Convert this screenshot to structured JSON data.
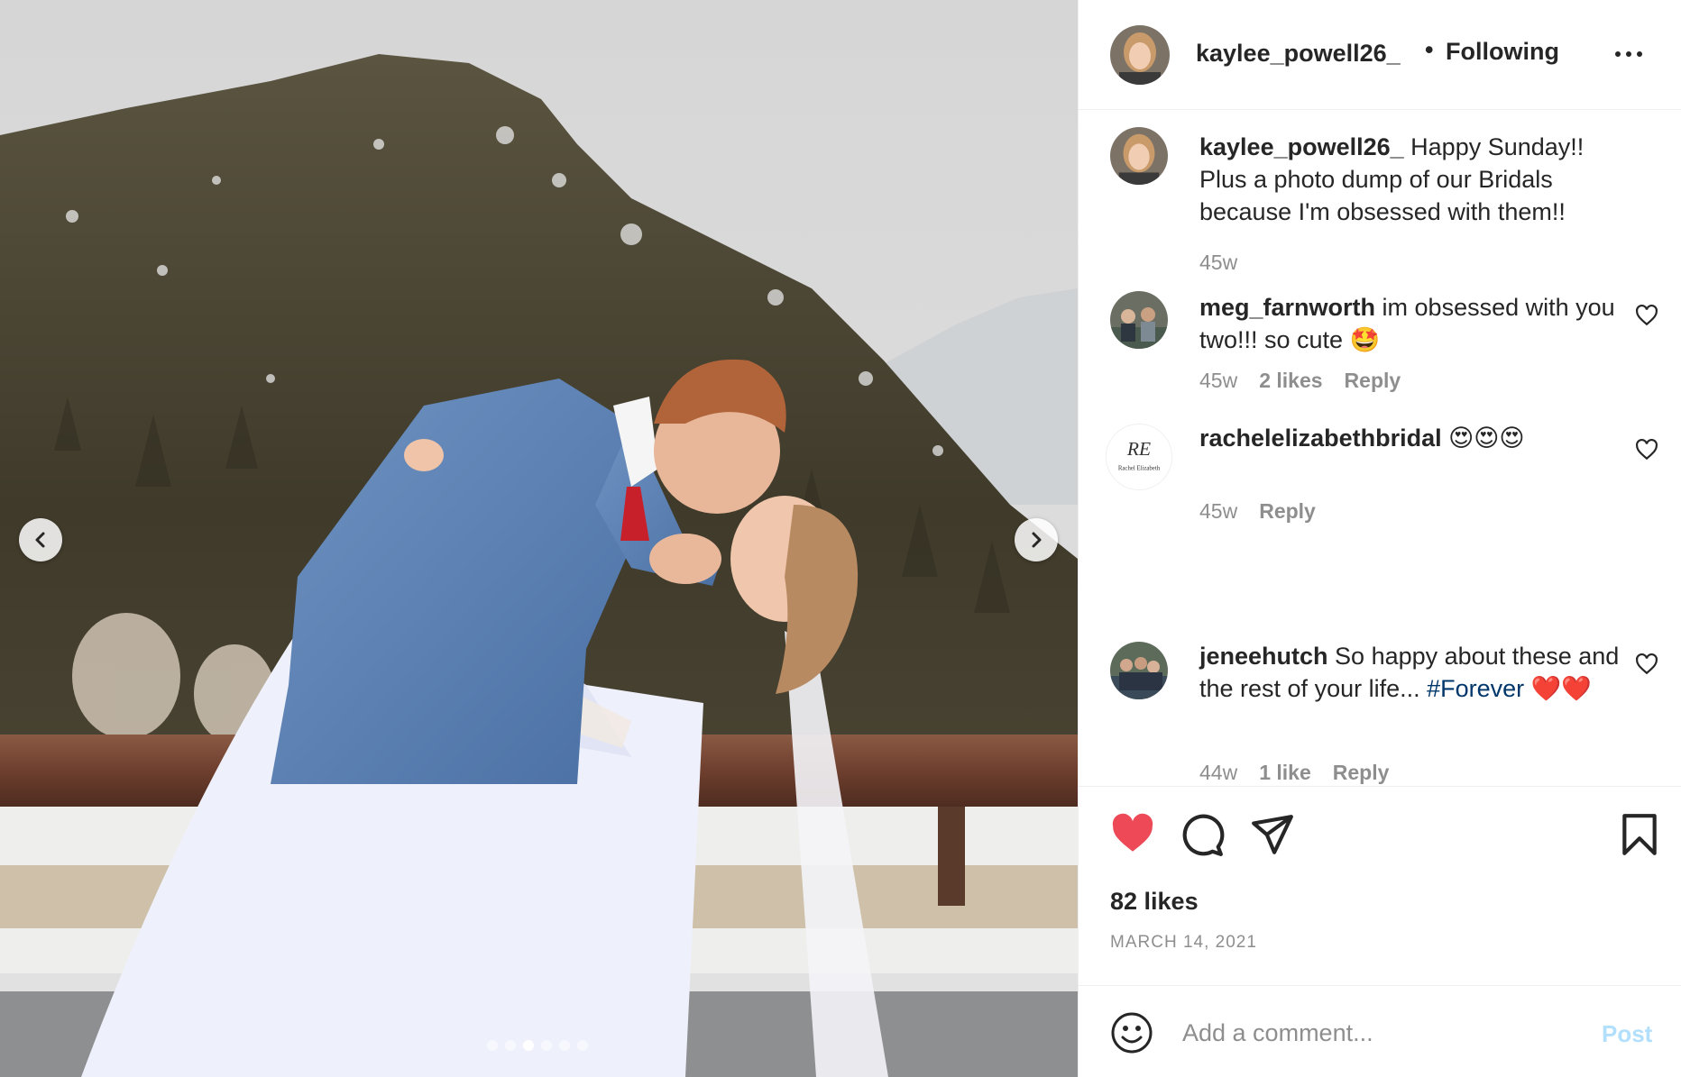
{
  "post": {
    "username": "kaylee_powell26_",
    "separator": "•",
    "follow_status": "Following",
    "caption": "Happy Sunday!! Plus a photo dump of our Bridals because I'm obsessed with them!!",
    "caption_age": "45w"
  },
  "carousel": {
    "total_slides": 6,
    "active_slide": 3
  },
  "comments": [
    {
      "username": "meg_farnworth",
      "text": "im obsessed with you two!!! so cute 🤩",
      "age": "45w",
      "likes": "2 likes",
      "reply": "Reply"
    },
    {
      "username": "rachelelizabethbridal",
      "text": "😍😍😍",
      "age": "45w",
      "likes": "",
      "reply": "Reply",
      "avatar_monogram": "RE",
      "avatar_caption": "Rachel Elizabeth"
    },
    {
      "username": "jeneehutch",
      "text_before": "So happy about these and the rest of your life... ",
      "hashtag": "#Forever",
      "text_after": "❤️❤️",
      "age": "44w",
      "likes": "1 like",
      "reply": "Reply"
    }
  ],
  "engagement": {
    "likes": "82 likes",
    "date": "MARCH 14, 2021",
    "liked": true
  },
  "add_comment": {
    "placeholder": "Add a comment...",
    "post_label": "Post"
  },
  "colors": {
    "like_red": "#ed4956",
    "text": "#262626",
    "secondary": "#8e8e8e",
    "link": "#00376b",
    "post_disabled": "#b2dffc"
  }
}
